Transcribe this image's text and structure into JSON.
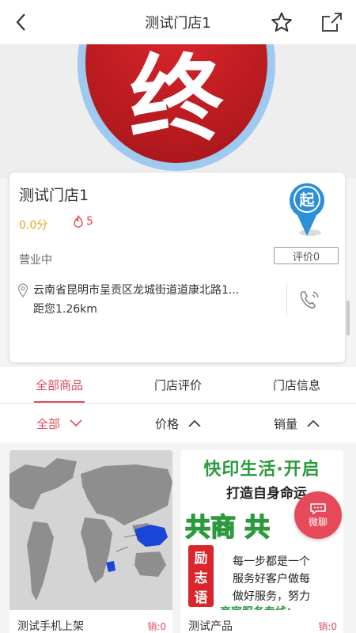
{
  "header": {
    "title": "测试门店1",
    "back_icon": "chevron-left-icon",
    "favorite_icon": "star-outline-icon",
    "share_icon": "share-icon"
  },
  "banner": {
    "logo_text": "终"
  },
  "store": {
    "name": "测试门店1",
    "score": "0.0分",
    "hot_count": "5",
    "status": "营业中",
    "badge_text": "起",
    "review_button": "评价0",
    "address": "云南省昆明市呈贡区龙城街道道康北路1...",
    "distance": "距您1.26km"
  },
  "tabs": [
    {
      "label": "全部商品",
      "active": true
    },
    {
      "label": "门店评价",
      "active": false
    },
    {
      "label": "门店信息",
      "active": false
    }
  ],
  "filters": {
    "all": "全部",
    "price": "价格",
    "sales": "销量"
  },
  "products": [
    {
      "name": "测试手机上架",
      "sales": "销:0"
    },
    {
      "name": "测试产品",
      "sales": "销:0"
    }
  ],
  "poster": {
    "line1": "快印生活·开启",
    "line2": "打造自身命运",
    "line3": "共商  共",
    "tag_chars": [
      "励",
      "志",
      "语"
    ],
    "p1": "每一步都是一个",
    "p2": "服务好客户做每",
    "p3": "做好服务，努力",
    "bottom": "商家服务专线："
  },
  "float": {
    "chat_label": "微聊"
  },
  "colors": {
    "accent": "#e14b5a",
    "score": "#f0a020",
    "logo_red": "#c81e24"
  }
}
